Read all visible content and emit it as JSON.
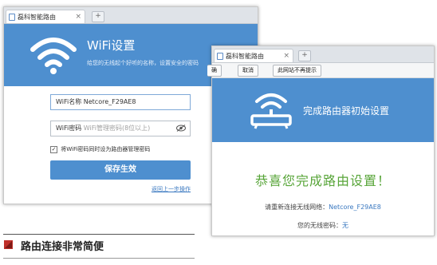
{
  "window1": {
    "tab_title": "磊科智能路由",
    "tab_close": "×",
    "new_tab": "+",
    "header": {
      "title": "WiFi设置",
      "subtitle": "给您的无线起个好听的名称，设置安全的密码"
    },
    "ssid": {
      "label": "WiFi名称",
      "value": "Netcore_F29AE8"
    },
    "password": {
      "label": "WiFi密码",
      "placeholder": "WiFi管理密码(8位以上)"
    },
    "checkbox": {
      "checked": true,
      "mark": "✓",
      "label": "将WiFi密码同时设为路由器管理密码"
    },
    "save_button": "保存生效",
    "back_link": "返回上一步操作"
  },
  "window2": {
    "tab_title": "磊科智能路由",
    "tab_close": "×",
    "new_tab": "+",
    "toolbar": {
      "left_cut": "确",
      "cancel": "取消",
      "no_prompt": "此网站不再提示"
    },
    "header": {
      "title": "完成路由器初始设置"
    },
    "congrats": "恭喜您完成路由设置！",
    "reconnect": {
      "label": "请重新连接无线网络：",
      "value": "Netcore_F29AE8"
    },
    "password": {
      "label": "您的无线密码：",
      "value": "无"
    }
  },
  "section": {
    "title": "路由连接非常简便"
  },
  "colors": {
    "brand_blue": "#4e8fcf",
    "success_green": "#58a539",
    "section_mark": "#c0302a"
  }
}
